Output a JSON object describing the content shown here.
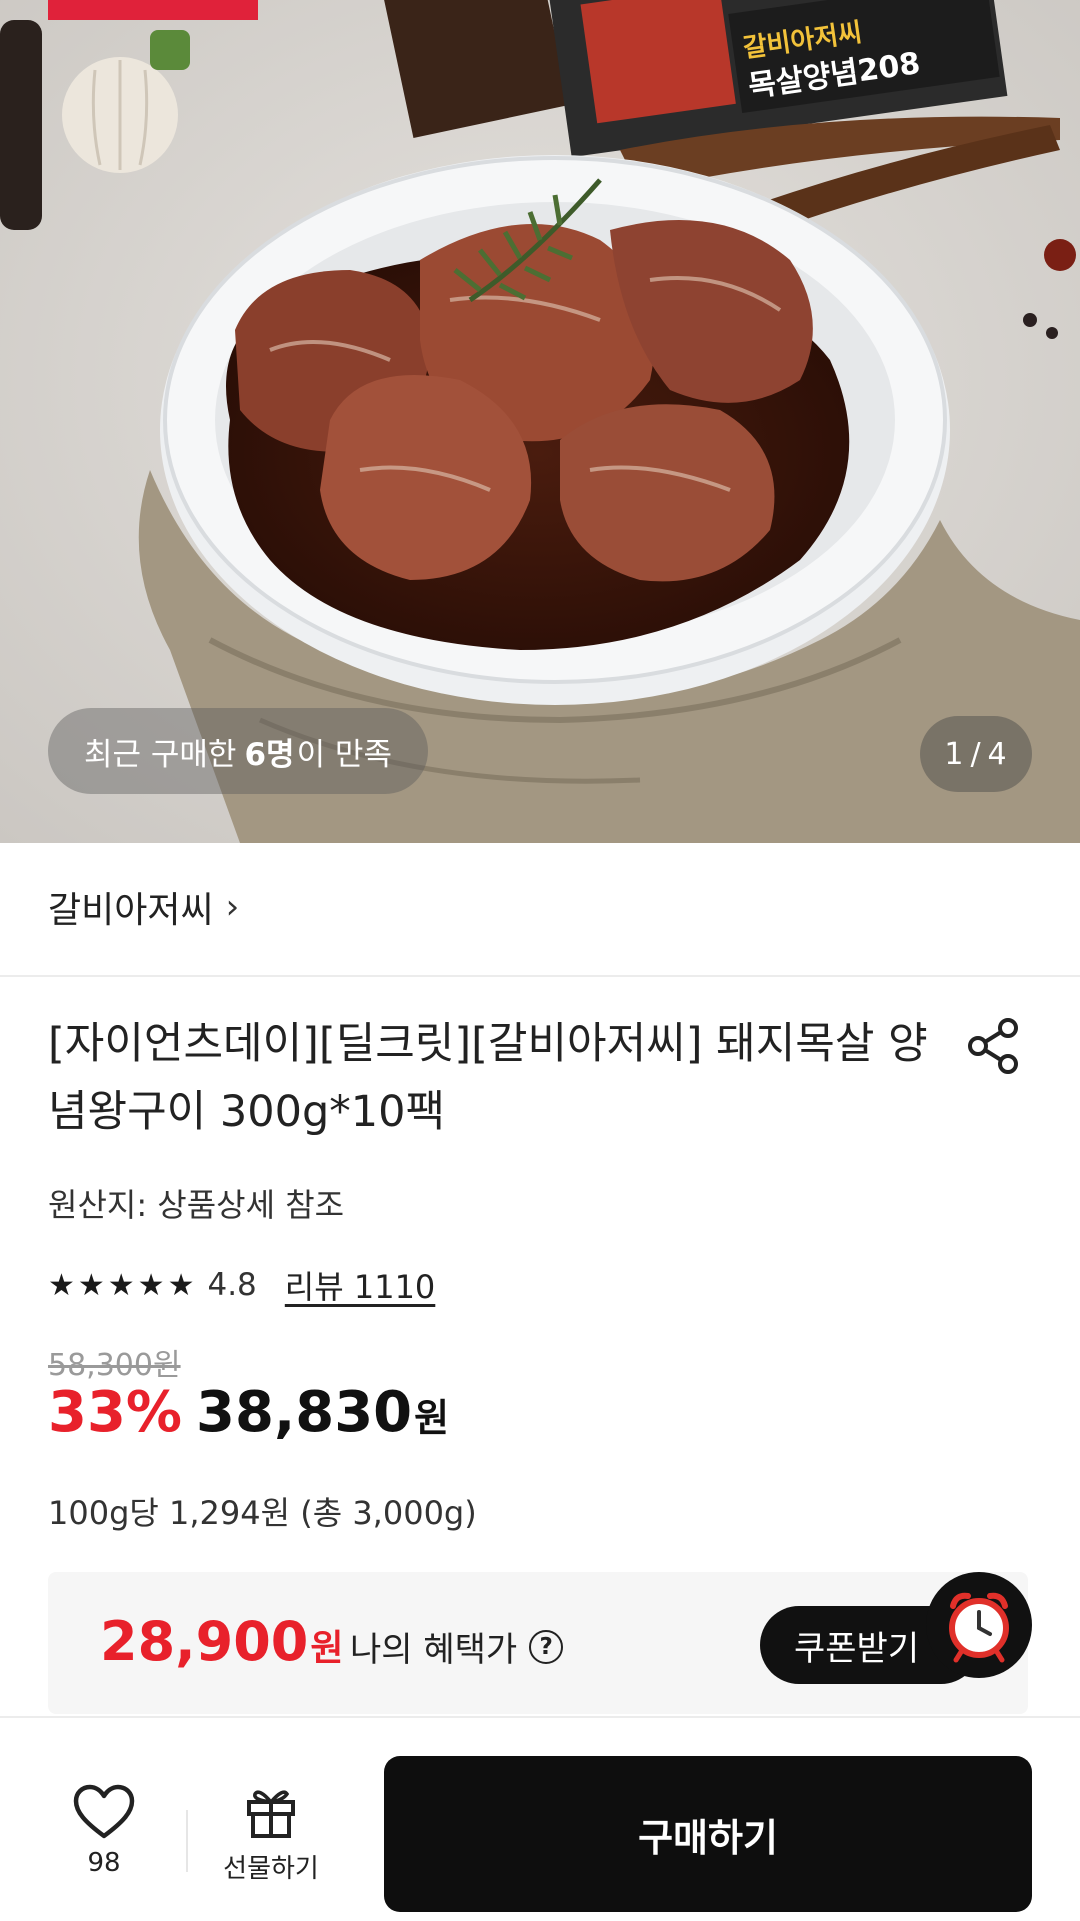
{
  "hero": {
    "buyers_prefix": "최근 구매한",
    "buyers_count": "6명",
    "buyers_suffix": "이 만족",
    "package_text_1": "갈비아저씨",
    "package_text_2": "목살양념208",
    "page_current": "1",
    "page_sep": "/",
    "page_total": "4"
  },
  "brand": {
    "name": "갈비아저씨",
    "chevron": "›"
  },
  "product": {
    "title": "[자이언츠데이][딜크릿][갈비아저씨] 돼지목살 양념왕구이 300g*10팩",
    "origin": "원산지: 상품상세 참조",
    "stars": "★★★★★",
    "rating_value": "4.8",
    "review_link": "리뷰 1110",
    "rating": 4.8,
    "original_price": "58,300원",
    "discount": "33%",
    "sale_price": "38,830",
    "sale_won": "원",
    "unit_price": "100g당 1,294원 (총 3,000g)"
  },
  "benefit": {
    "price": "28,900",
    "won": "원",
    "label": "나의 혜택가",
    "help": "?",
    "coupon_label": "쿠폰받기"
  },
  "bottom_bar": {
    "wish_count": "98",
    "gift_label": "선물하기",
    "buy_label": "구매하기"
  },
  "colors": {
    "accent_red": "#e8212b",
    "buy_button": "#0e0e0e",
    "benefit_bg": "#f6f6f6"
  }
}
